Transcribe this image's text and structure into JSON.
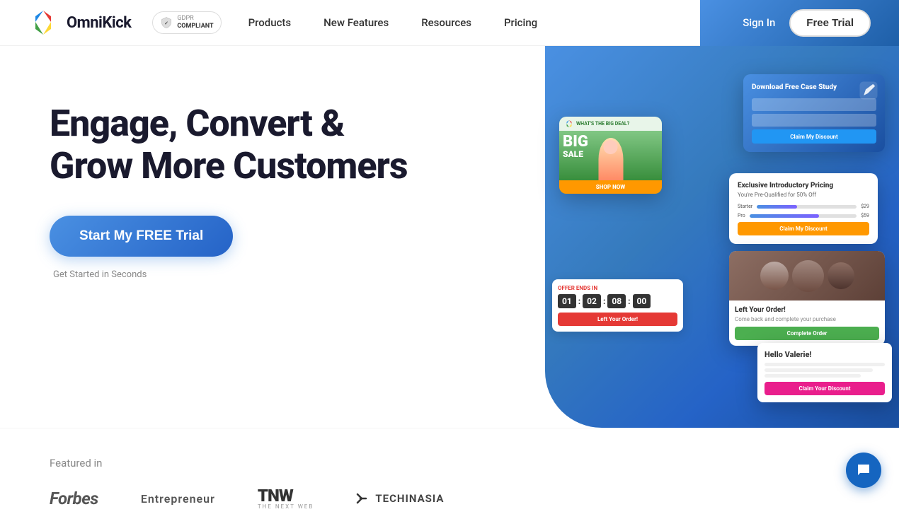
{
  "header": {
    "logo_text": "OmniKick",
    "gdpr_top": "GDPR",
    "gdpr_bottom": "COMPLIANT",
    "nav": [
      {
        "label": "Products",
        "id": "products"
      },
      {
        "label": "New Features",
        "id": "new-features"
      },
      {
        "label": "Resources",
        "id": "resources"
      },
      {
        "label": "Pricing",
        "id": "pricing"
      }
    ],
    "sign_in": "Sign In",
    "free_trial": "Free Trial"
  },
  "hero": {
    "headline_line1": "Engage, Convert &",
    "headline_line2": "Grow More Customers",
    "cta_button": "Start My FREE Trial",
    "cta_subtext": "Get Started in Seconds"
  },
  "mockups": {
    "card1_title": "Download Free Case Study",
    "card1_btn1": "Claim My Discount",
    "card2_header": "WHAT'S THE BIG DEAL?",
    "card2_sale": "BIG",
    "card2_sale2": "SALE",
    "card2_shopbtn": "SHOP NOW",
    "card3_title": "Exclusive Introductory Pricing",
    "card3_sub": "You're Pre-Qualified for 50% Off",
    "card3_btn": "Claim My Discount",
    "card4_offer": "OFFER ENDS IN",
    "card4_t1": "01",
    "card4_t2": "02",
    "card4_t3": "08",
    "card4_t4": "00",
    "card4_btn": "Left Your Order!",
    "card5_title": "Left Your Order!",
    "card5_text": "Come back and complete your purchase",
    "card5_btn": "Complete Order",
    "card6_hi": "Hello Valerie!",
    "card6_btn": "Claim Your Discount"
  },
  "featured": {
    "title": "Featured in",
    "logos": [
      {
        "name": "Forbes",
        "style": "forbes"
      },
      {
        "name": "Entrepreneur",
        "style": "entrepreneur"
      },
      {
        "name": "TNW",
        "sub": "THE NEXT WEB",
        "style": "tnw"
      },
      {
        "name": "TECHINASIA",
        "style": "techinasia"
      }
    ]
  },
  "chat": {
    "icon": "💬"
  }
}
